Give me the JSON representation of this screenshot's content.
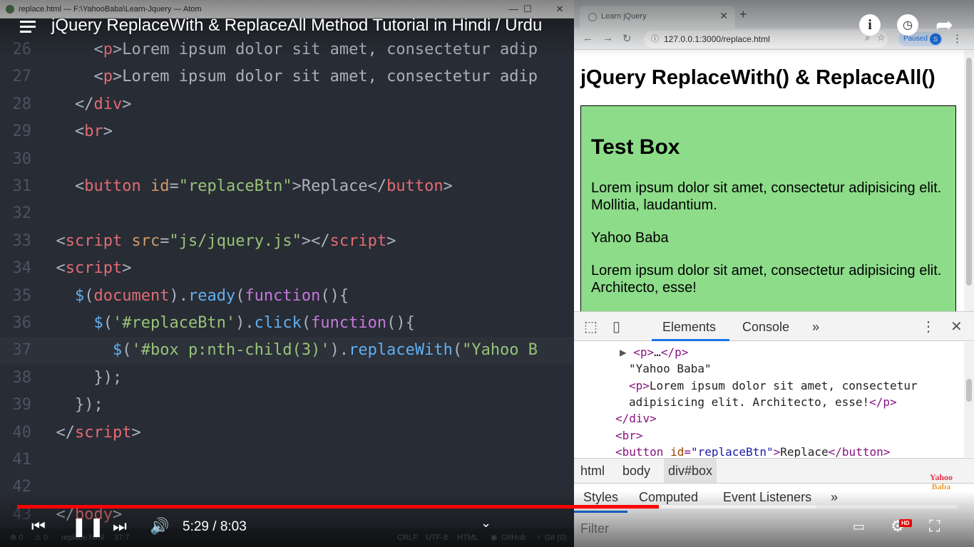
{
  "atom": {
    "window_title": "replace.html — F:\\YahooBaba\\Learn-Jquery — Atom",
    "window_controls": [
      "—",
      "☐",
      "✕"
    ],
    "lines": [
      {
        "num": "26",
        "html": "<span class=\"c-txt\">      </span><span class=\"c-punct\">&lt;</span><span class=\"c-tag\">p</span><span class=\"c-punct\">&gt;</span><span class=\"c-txt\">Lorem ipsum dolor sit amet, consectetur adip</span>"
      },
      {
        "num": "27",
        "html": "<span class=\"c-txt\">      </span><span class=\"c-punct\">&lt;</span><span class=\"c-tag\">p</span><span class=\"c-punct\">&gt;</span><span class=\"c-txt\">Lorem ipsum dolor sit amet, consectetur adip</span>"
      },
      {
        "num": "28",
        "html": "<span class=\"c-txt\">    </span><span class=\"c-punct\">&lt;/</span><span class=\"c-tag\">div</span><span class=\"c-punct\">&gt;</span>"
      },
      {
        "num": "29",
        "html": "<span class=\"c-txt\">    </span><span class=\"c-punct\">&lt;</span><span class=\"c-tag\">br</span><span class=\"c-punct\">&gt;</span>"
      },
      {
        "num": "30",
        "html": ""
      },
      {
        "num": "31",
        "html": "<span class=\"c-txt\">    </span><span class=\"c-punct\">&lt;</span><span class=\"c-tag\">button</span> <span class=\"c-attr\">id</span><span class=\"c-punct\">=</span><span class=\"c-str\">\"replaceBtn\"</span><span class=\"c-punct\">&gt;</span><span class=\"c-txt\">Replace</span><span class=\"c-punct\">&lt;/</span><span class=\"c-tag\">button</span><span class=\"c-punct\">&gt;</span>"
      },
      {
        "num": "32",
        "html": ""
      },
      {
        "num": "33",
        "html": "<span class=\"c-txt\">  </span><span class=\"c-punct\">&lt;</span><span class=\"c-tag\">script</span> <span class=\"c-attr\">src</span><span class=\"c-punct\">=</span><span class=\"c-str\">\"js/jquery.js\"</span><span class=\"c-punct\">&gt;&lt;/</span><span class=\"c-tag\">script</span><span class=\"c-punct\">&gt;</span>"
      },
      {
        "num": "34",
        "html": "<span class=\"c-txt\">  </span><span class=\"c-punct\">&lt;</span><span class=\"c-tag\">script</span><span class=\"c-punct\">&gt;</span>"
      },
      {
        "num": "35",
        "html": "<span class=\"c-txt\">    </span><span class=\"c-fn\">$</span><span class=\"c-punct\">(</span><span class=\"c-tag\">document</span><span class=\"c-punct\">).</span><span class=\"c-fn\">ready</span><span class=\"c-punct\">(</span><span class=\"c-kw\">function</span><span class=\"c-punct\">(){</span>"
      },
      {
        "num": "36",
        "html": "<span class=\"c-txt\">      </span><span class=\"c-fn\">$</span><span class=\"c-punct\">(</span><span class=\"c-str\">'#replaceBtn'</span><span class=\"c-punct\">).</span><span class=\"c-fn\">click</span><span class=\"c-punct\">(</span><span class=\"c-kw\">function</span><span class=\"c-punct\">(){</span>"
      },
      {
        "num": "37",
        "html": "<span class=\"c-txt\">        </span><span class=\"c-fn\">$</span><span class=\"c-punct\">(</span><span class=\"c-str\">'#box p:nth-child(3)'</span><span class=\"c-punct\">).</span><span class=\"c-fn\">replaceWith</span><span class=\"c-punct\">(</span><span class=\"c-str\">\"Yahoo B</span>",
        "cursor": true
      },
      {
        "num": "38",
        "html": "<span class=\"c-txt\">      </span><span class=\"c-punct\">});</span>"
      },
      {
        "num": "39",
        "html": "<span class=\"c-txt\">    </span><span class=\"c-punct\">});</span>"
      },
      {
        "num": "40",
        "html": "<span class=\"c-txt\">  </span><span class=\"c-punct\">&lt;/</span><span class=\"c-tag\">script</span><span class=\"c-punct\">&gt;</span>"
      },
      {
        "num": "41",
        "html": ""
      },
      {
        "num": "42",
        "html": ""
      },
      {
        "num": "43",
        "html": "<span class=\"c-txt\">  </span><span class=\"c-punct\">&lt;/</span><span class=\"c-tag\">body</span><span class=\"c-punct\">&gt;</span>"
      }
    ],
    "status": {
      "errors": "⊗ 0",
      "warnings": "⚠ 0",
      "file": "replace.html",
      "position": "37:7",
      "line_ending": "CRLF",
      "encoding": "UTF-8",
      "grammar": "HTML",
      "github": "GitHub",
      "git": "Git (0)"
    }
  },
  "browser": {
    "tab_title": "Learn jQuery",
    "tab_close": "✕",
    "new_tab": "+",
    "url": "127.0.0.1:3000/replace.html",
    "profile_status": "Paused",
    "profile_initial": "S",
    "page": {
      "heading": "jQuery ReplaceWith() & ReplaceAll()",
      "box_heading": "Test Box",
      "paragraphs": [
        "Lorem ipsum dolor sit amet, consectetur adipisicing elit. Mollitia, laudantium.",
        "Yahoo Baba",
        "Lorem ipsum dolor sit amet, consectetur adipisicing elit. Architecto, esse!"
      ],
      "box_color": "#8ddc8a"
    },
    "devtools": {
      "tabs": [
        "Elements",
        "Console"
      ],
      "more": "»",
      "close": "✕",
      "dom_lines": [
        {
          "indent": 64,
          "html": "<span style=\"color:#555\">▶ </span><span class=\"dom-tag\">&lt;p&gt;</span><span class=\"dom-text\">…</span><span class=\"dom-tag\">&lt;/p&gt;</span>"
        },
        {
          "indent": 77,
          "html": "<span class=\"dom-text\">\"Yahoo Baba\"</span>"
        },
        {
          "indent": 77,
          "html": "<span class=\"dom-tag\">&lt;p&gt;</span><span class=\"dom-text\">Lorem ipsum dolor sit amet, consectetur</span>"
        },
        {
          "indent": 77,
          "html": "<span class=\"dom-text\">adipisicing elit. Architecto, esse!</span><span class=\"dom-tag\">&lt;/p&gt;</span>"
        },
        {
          "indent": 58,
          "html": "<span class=\"dom-tag\">&lt;/div&gt;</span>"
        },
        {
          "indent": 58,
          "html": "<span class=\"dom-tag\">&lt;br&gt;</span>"
        },
        {
          "indent": 58,
          "html": "<span class=\"dom-tag\">&lt;button</span> <span class=\"dom-attr\">id</span><span class=\"dom-tag\">=</span><span class=\"dom-val\">\"replaceBtn\"</span><span class=\"dom-tag\">&gt;</span><span class=\"dom-text\">Replace</span><span class=\"dom-tag\">&lt;/button&gt;</span>"
        }
      ],
      "breadcrumbs": [
        "html",
        "body",
        "div#box"
      ],
      "style_tabs": [
        "Styles",
        "Computed",
        "Event Listeners"
      ],
      "filter_placeholder": "Filter"
    }
  },
  "youtube": {
    "title": "jQuery ReplaceWith & ReplaceAll Method Tutorial in Hindi / Urdu",
    "time": "5:29 / 8:03",
    "progress_played": 0.683,
    "progress_loaded": 0.85,
    "hd_badge": "HD",
    "info_glyph": "i",
    "watermark_line1": "Yahoo",
    "watermark_line2": "Baba",
    "accent_color": "#ff0000"
  }
}
